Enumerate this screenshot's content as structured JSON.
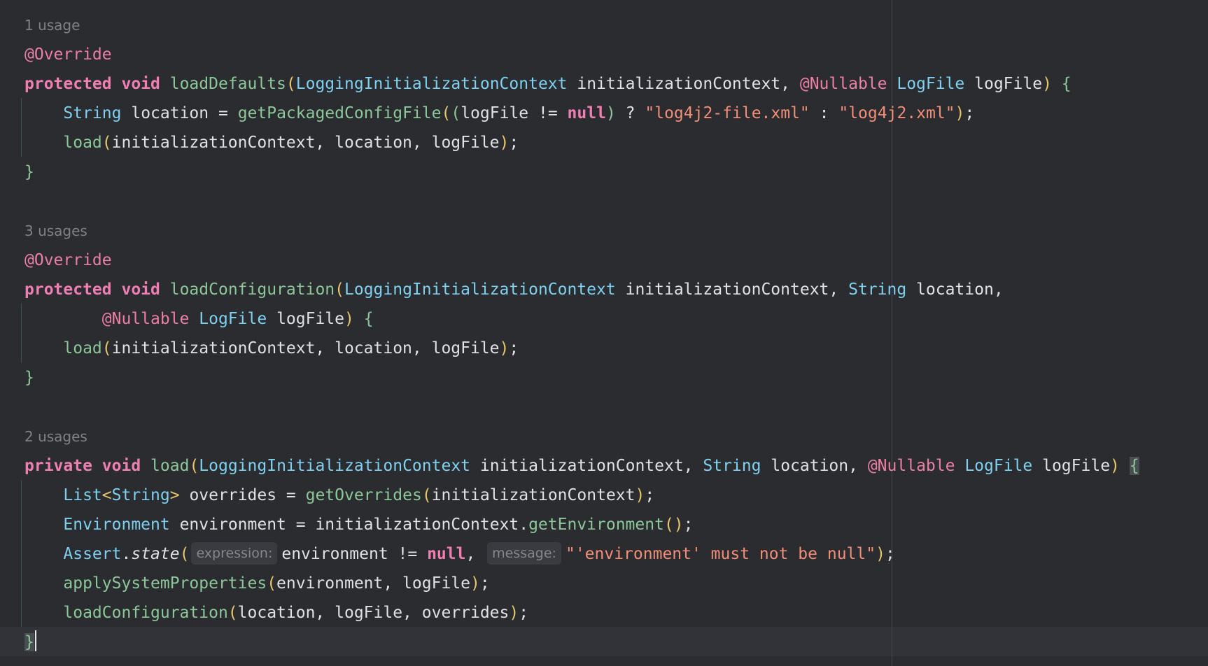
{
  "editor": {
    "blocks": [
      {
        "usage_hint": "1 usage",
        "annotation": "@Override",
        "sig_kw1": "protected",
        "sig_kw2": "void",
        "sig_name": "loadDefaults",
        "sig_type1": "LoggingInitializationContext",
        "sig_param1": "initializationContext,",
        "sig_ann": "@Nullable",
        "sig_type2": "LogFile",
        "sig_param2": "logFile",
        "body1_type": "String",
        "body1_var": "location =",
        "body1_fn": "getPackagedConfigFile",
        "body1_arg": "logFile !=",
        "body1_null": "null",
        "body1_op": "?",
        "body1_str1": "\"log4j2-file.xml\"",
        "body1_colon": ":",
        "body1_str2": "\"log4j2.xml\"",
        "body2_fn": "load",
        "body2_args": "initializationContext, location, logFile"
      },
      {
        "usage_hint": "3 usages",
        "annotation": "@Override",
        "sig_kw1": "protected",
        "sig_kw2": "void",
        "sig_name": "loadConfiguration",
        "sig_type1": "LoggingInitializationContext",
        "sig_param1": "initializationContext,",
        "sig_type_str": "String",
        "sig_param_loc": "location,",
        "cont_ann": "@Nullable",
        "cont_type": "LogFile",
        "cont_param": "logFile",
        "body_fn": "load",
        "body_args": "initializationContext, location, logFile"
      },
      {
        "usage_hint": "2 usages",
        "sig_kw1": "private",
        "sig_kw2": "void",
        "sig_name": "load",
        "sig_type1": "LoggingInitializationContext",
        "sig_param1": "initializationContext,",
        "sig_type_str": "String",
        "sig_param_loc": "location,",
        "sig_ann": "@Nullable",
        "sig_type2": "LogFile",
        "sig_param2": "logFile",
        "l1_type1": "List",
        "l1_type2": "String",
        "l1_var": "overrides =",
        "l1_fn": "getOverrides",
        "l1_arg": "initializationContext",
        "l2_type": "Environment",
        "l2_var": "environment = initializationContext.",
        "l2_fn": "getEnvironment",
        "l3_type": "Assert",
        "l3_fn": "state",
        "l3_hint1": "expression:",
        "l3_arg": "environment !=",
        "l3_null": "null",
        "l3_hint2": "message:",
        "l3_str": "\"'environment' must not be null\"",
        "l4_fn": "applySystemProperties",
        "l4_args": "environment, logFile",
        "l5_fn": "loadConfiguration",
        "l5_args": "location, logFile, overrides"
      }
    ]
  }
}
